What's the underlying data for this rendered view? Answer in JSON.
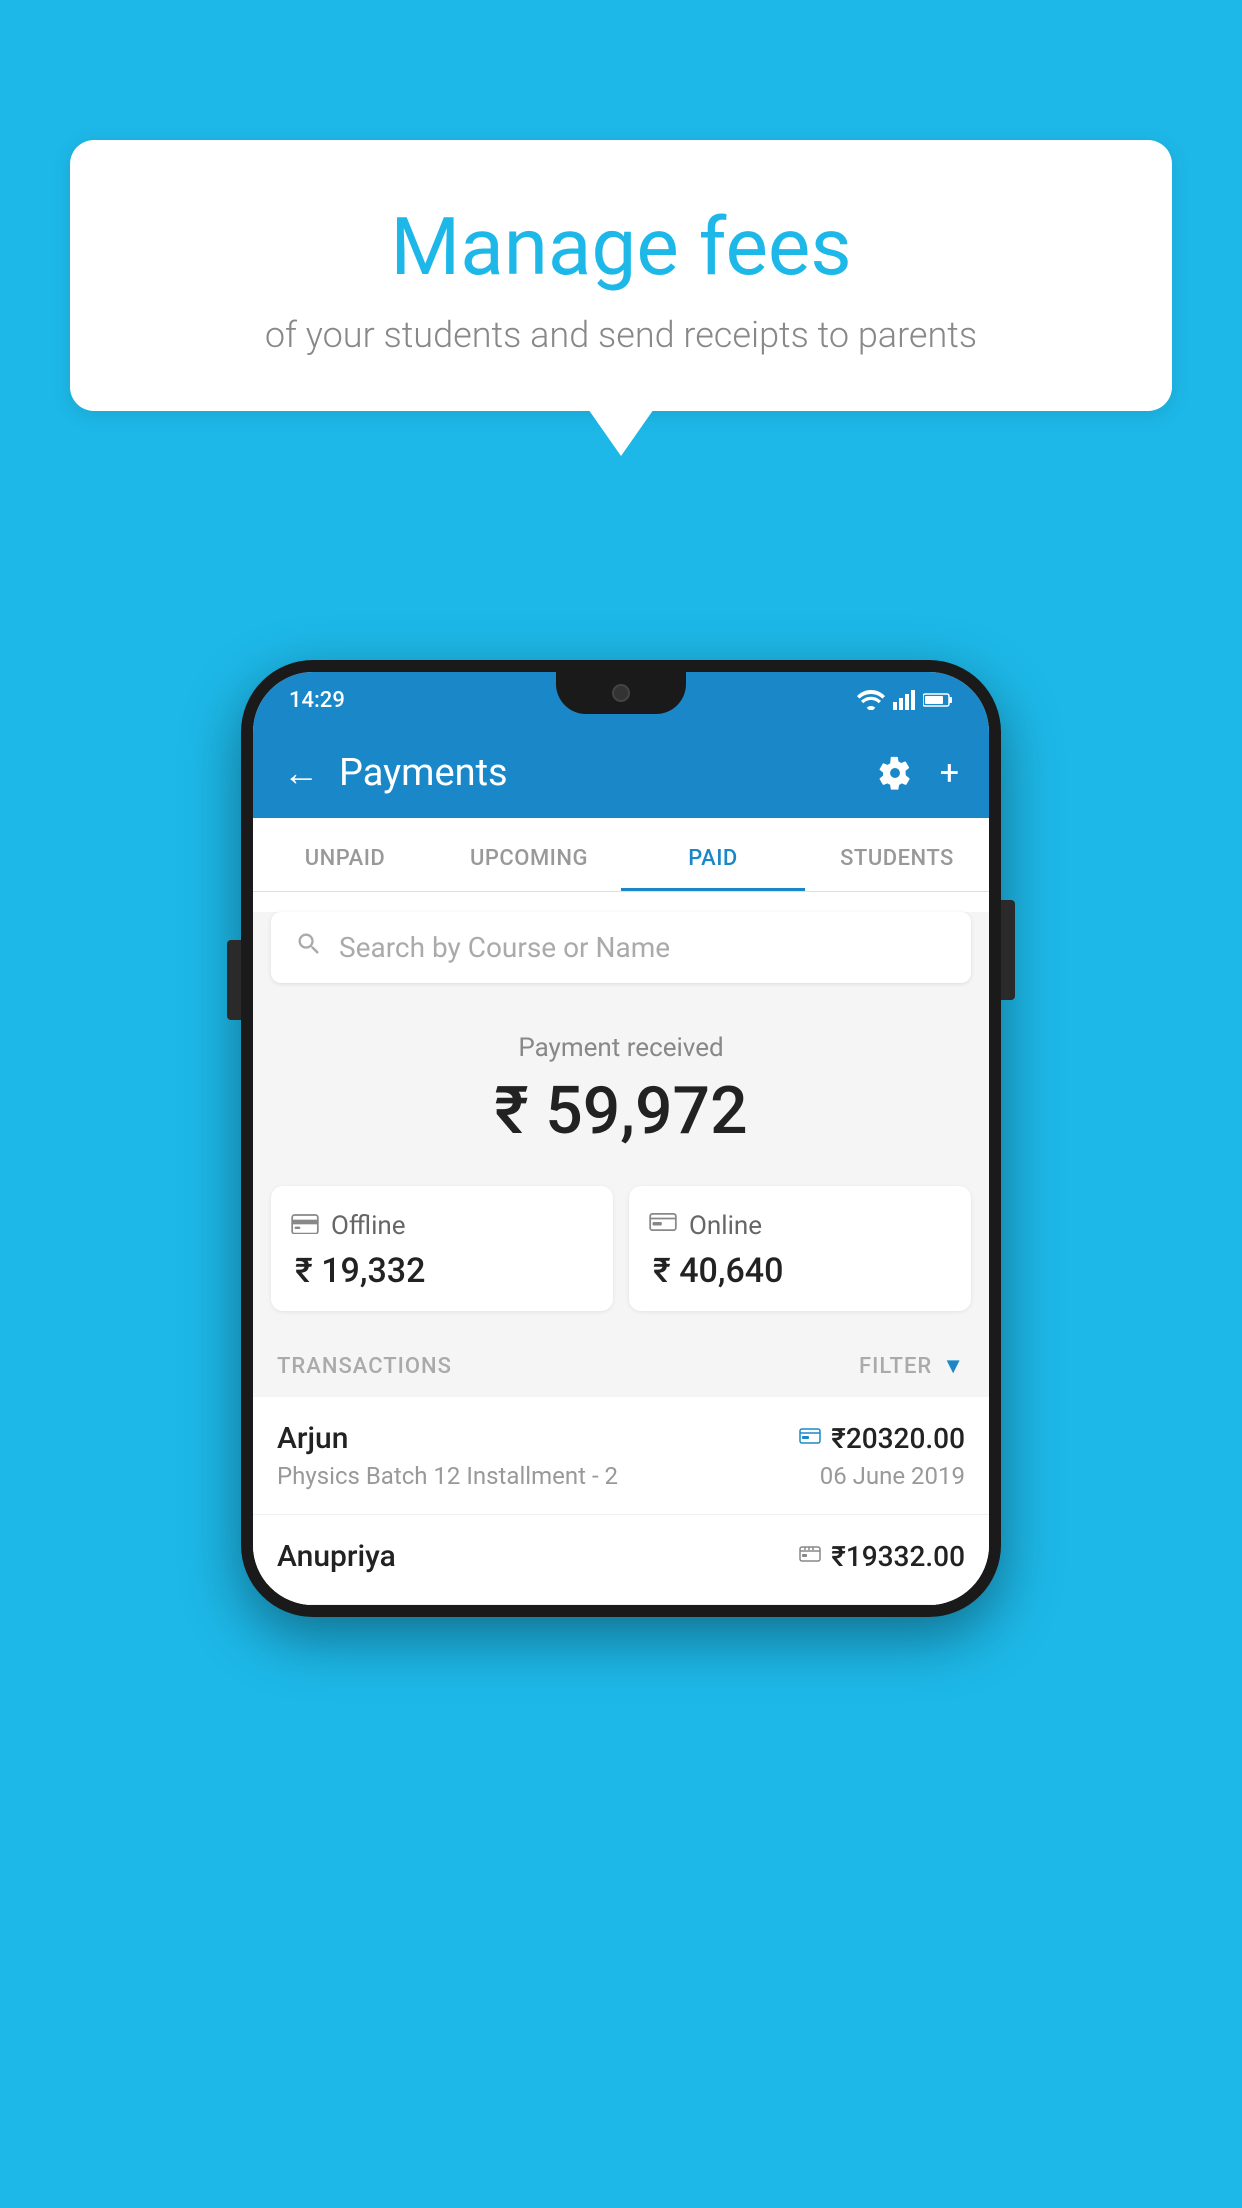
{
  "background_color": "#1db8e8",
  "speech_bubble": {
    "title": "Manage fees",
    "subtitle": "of your students and send receipts to parents"
  },
  "phone": {
    "status_bar": {
      "time": "14:29"
    },
    "header": {
      "title": "Payments",
      "back_label": "←",
      "settings_label": "⚙",
      "add_label": "+"
    },
    "tabs": [
      {
        "label": "UNPAID",
        "active": false
      },
      {
        "label": "UPCOMING",
        "active": false
      },
      {
        "label": "PAID",
        "active": true
      },
      {
        "label": "STUDENTS",
        "active": false
      }
    ],
    "search": {
      "placeholder": "Search by Course or Name"
    },
    "payment_received": {
      "label": "Payment received",
      "amount": "₹ 59,972"
    },
    "payment_cards": [
      {
        "type": "Offline",
        "amount": "₹ 19,332",
        "icon": "offline"
      },
      {
        "type": "Online",
        "amount": "₹ 40,640",
        "icon": "online"
      }
    ],
    "transactions_label": "TRANSACTIONS",
    "filter_label": "FILTER",
    "transactions": [
      {
        "name": "Arjun",
        "course": "Physics Batch 12 Installment - 2",
        "amount": "₹20320.00",
        "date": "06 June 2019",
        "type": "online"
      },
      {
        "name": "Anupriya",
        "course": "",
        "amount": "₹19332.00",
        "date": "",
        "type": "offline"
      }
    ]
  }
}
